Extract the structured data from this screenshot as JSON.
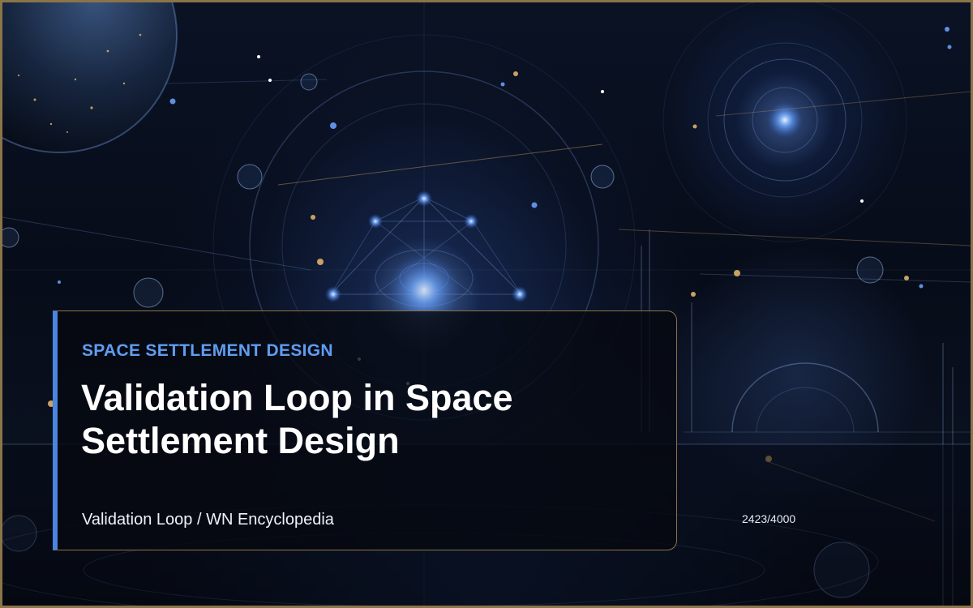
{
  "slide": {
    "category": "SPACE SETTLEMENT DESIGN",
    "title": "Validation Loop in Space Settlement Design",
    "footer": "Validation Loop / WN Encyclopedia",
    "counter": "2423/4000"
  },
  "theme": {
    "accent": "#4a85e0",
    "category_color": "#5f9df0",
    "frame_gold": "#8a7448",
    "background": "#070c19"
  }
}
